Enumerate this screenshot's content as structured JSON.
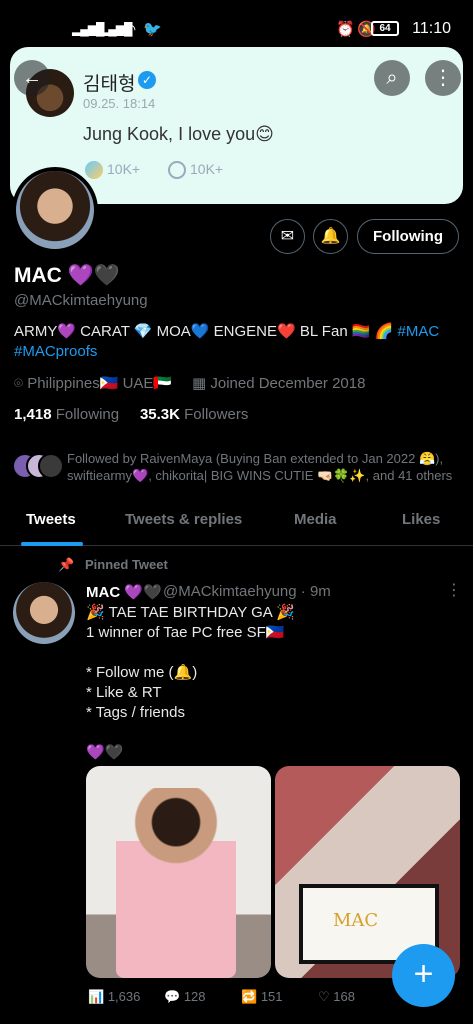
{
  "status_bar": {
    "time": "11:10",
    "battery": "64"
  },
  "banner": {
    "name": "김태형",
    "date": "09.25. 18:14",
    "text": "Jung Kook, I love you😊",
    "stat1": "10K+",
    "stat2": "10K+"
  },
  "profile": {
    "display_name": "MAC 💜🖤",
    "handle": "@MACkimtaehyung",
    "bio_text": "ARMY💜 CARAT 💎 MOA💙 ENGENE❤️ BL Fan 🏳️‍🌈 🌈",
    "bio_links": [
      "#MAC",
      "#MACproofs"
    ],
    "location": "Philippines🇵🇭 UAE🇦🇪",
    "joined": "Joined December 2018",
    "following_count": "1,418",
    "following_label": "Following",
    "followers_count": "35.3K",
    "followers_label": "Followers",
    "follow_button": "Following",
    "followed_by": "Followed by RaivenMaya (Buying Ban extended to Jan 2022 😤), swiftiearmy💜, chikorita| BIG WINS CUTIE 🤜🏻🍀✨, and 41 others"
  },
  "tabs": [
    "Tweets",
    "Tweets & replies",
    "Media",
    "Likes"
  ],
  "tweet": {
    "pinned_label": "Pinned Tweet",
    "name": "MAC 💜🖤",
    "handle_time": "@MACkimtaehyung · 9m",
    "body": "🎉 TAE TAE BIRTHDAY GA 🎉\n1 winner of Tae PC free SF🇵🇭\n\n* Follow me (🔔)\n* Like & RT\n* Tags / friends\n\n💜🖤",
    "polaroid_text": "MAC",
    "views": "1,636",
    "replies": "128",
    "retweets": "151",
    "likes": "168"
  },
  "icons": {
    "back": "arrow-left-icon",
    "search": "search-icon",
    "more": "more-vertical-icon",
    "message": "envelope-icon",
    "notify": "bell-icon",
    "compose": "plus-icon"
  },
  "colors": {
    "accent": "#1d9bf0",
    "background": "#000000",
    "banner": "#e3faf5"
  }
}
